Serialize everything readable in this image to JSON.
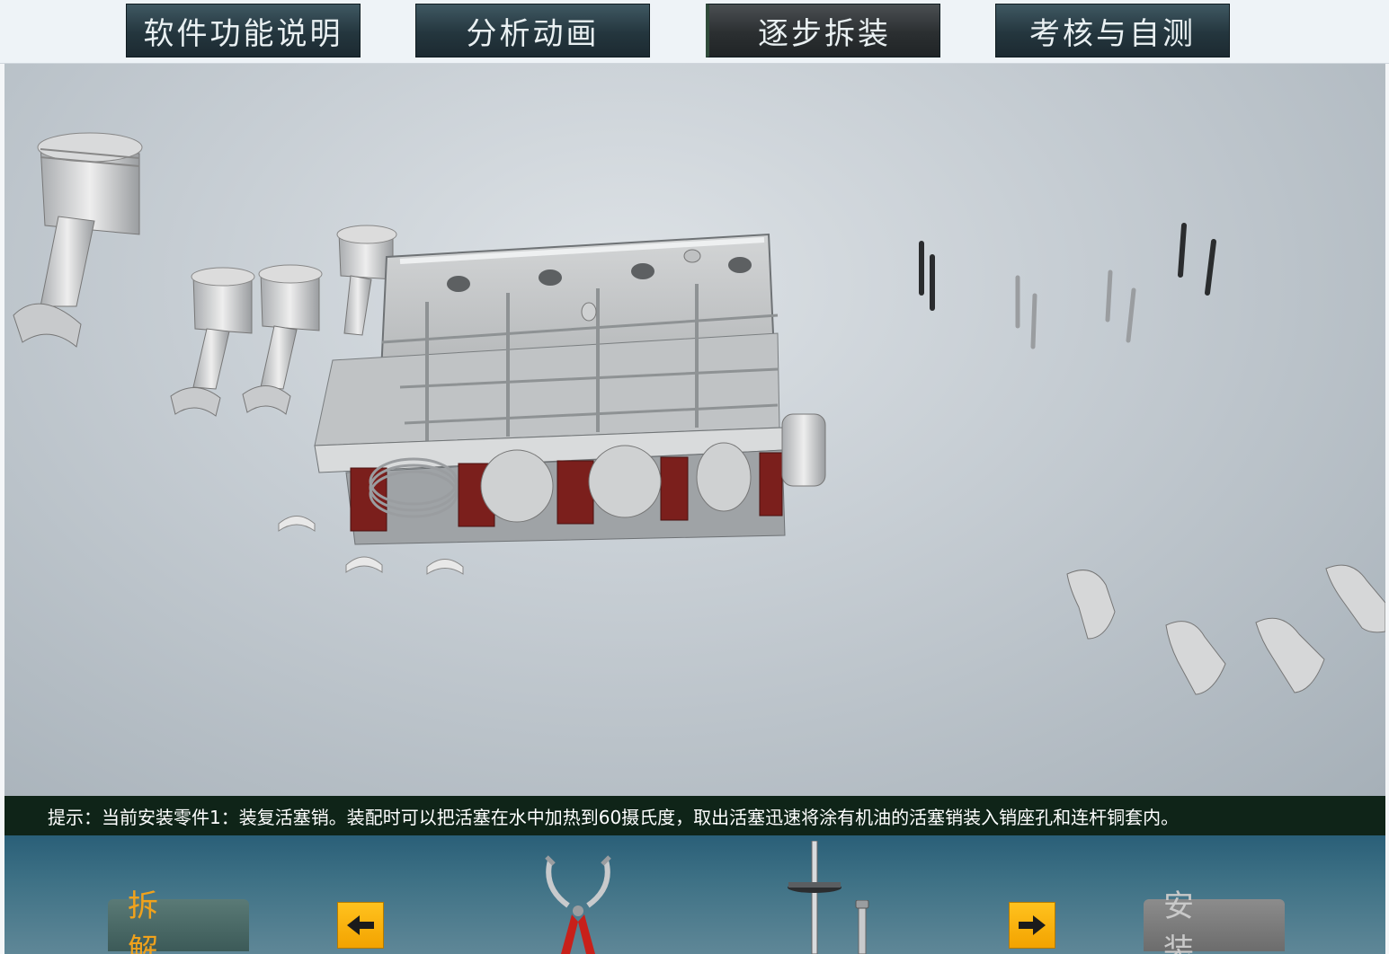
{
  "nav": {
    "items": [
      {
        "label": "软件功能说明"
      },
      {
        "label": "分析动画"
      },
      {
        "label": "逐步拆装"
      },
      {
        "label": "考核与自测"
      }
    ],
    "active_index": 2
  },
  "hint": {
    "text": "提示：当前安装零件1：装复活塞销。装配时可以把活塞在水中加热到60摄氏度，取出活塞迅速将涂有机油的活塞销装入销座孔和连杆铜套内。"
  },
  "tray": {
    "disassemble_label": "拆 解",
    "assemble_label": "安 装",
    "prev_icon": "arrow-left-icon",
    "next_icon": "arrow-right-icon",
    "tools": [
      "piston-ring-pliers-icon",
      "torque-wrench-icon",
      "pin-tool-icon"
    ]
  },
  "colors": {
    "nav_bg": "#24363e",
    "hint_bg": "#0f2418",
    "tray_bg": "#3f7286",
    "arrow_yellow": "#f3a300",
    "disassemble_text": "#f0a21c"
  }
}
